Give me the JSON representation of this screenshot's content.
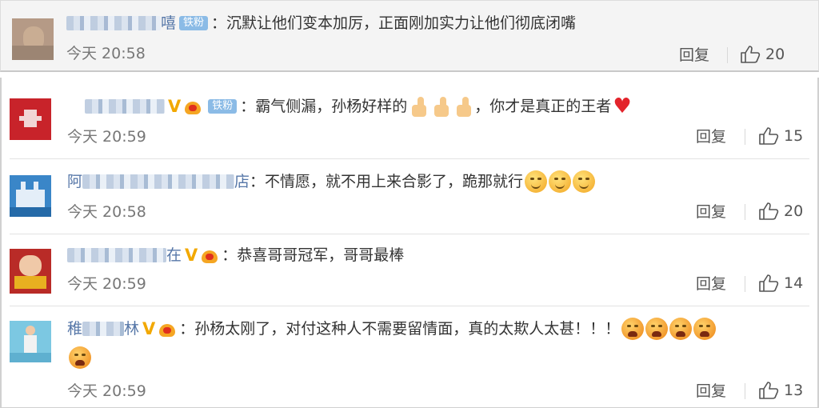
{
  "comments": [
    {
      "id": "c1",
      "username_suffix": "嘻",
      "badge": "铁粉",
      "text": "：沉默让他们变本加厉，正面刚加实力让他们彻底闭嘴",
      "time": "今天 20:58",
      "reply_label": "回复",
      "likes": "20"
    },
    {
      "id": "c2",
      "username_suffix": "",
      "badge": "铁粉",
      "text": "：霸气侧漏，孙杨好样的",
      "text2": "，你才是真正的王者",
      "time": "今天 20:59",
      "reply_label": "回复",
      "likes": "15"
    },
    {
      "id": "c3",
      "username_prefix": "阿",
      "username_suffix": "店",
      "text": "：不情愿，就不用上来合影了，跪那就行",
      "time": "今天 20:58",
      "reply_label": "回复",
      "likes": "20"
    },
    {
      "id": "c4",
      "username_suffix": "在",
      "text": "：恭喜哥哥冠军，哥哥最棒",
      "time": "今天 20:59",
      "reply_label": "回复",
      "likes": "14"
    },
    {
      "id": "c5",
      "username_prefix": "稚",
      "username_suffix": "林",
      "text": "：孙杨太刚了，对付这种人不需要留情面，真的太欺人太甚！！！",
      "time": "今天 20:59",
      "reply_label": "回复",
      "likes": "13"
    }
  ],
  "colors": {
    "username_link": "#5677a8",
    "vip_gold": "#f2a800",
    "badge_blue": "#8bbbe6",
    "meta_gray": "#777777"
  },
  "icons": {
    "like": "thumbs-up-outline-icon",
    "verified": "v-verified-icon",
    "member_crown": "crown-icon"
  }
}
